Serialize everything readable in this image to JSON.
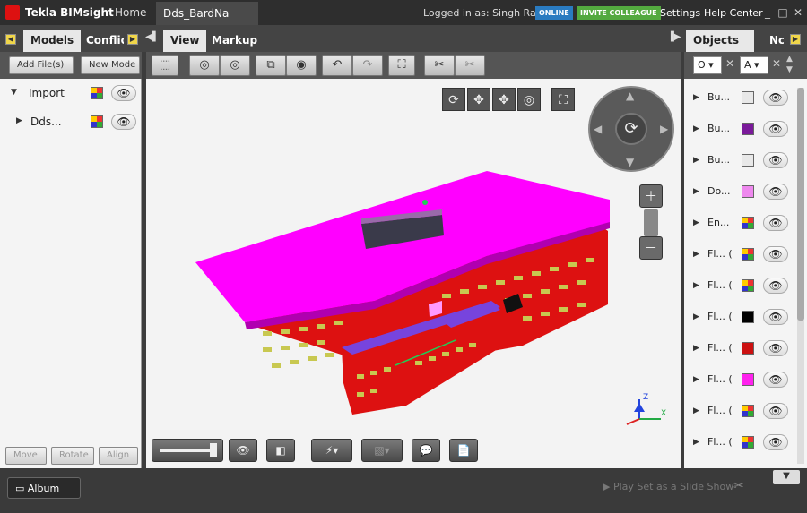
{
  "titlebar": {
    "app_name": "Tekla BIMsight",
    "home_tab": "Home",
    "document_tab": "Dds_BardNa",
    "logged_in": "Logged in as: Singh Rajan",
    "online_badge": "ONLINE",
    "invite_button": "INVITE COLLEAGUE",
    "settings": "Settings",
    "help": "Help Center",
    "minimize": "_",
    "maximize": "□",
    "close": "✕"
  },
  "left_panel": {
    "tabs": [
      "Models",
      "Conflic"
    ],
    "add_files": "Add File(s)",
    "new_model": "New Mode",
    "tree": [
      {
        "label": "Import"
      },
      {
        "label": "Dds..."
      }
    ],
    "footer_buttons": [
      "Move",
      "Rotate",
      "Align"
    ]
  },
  "center_panel": {
    "tabs": [
      "View",
      "Markup"
    ]
  },
  "right_panel": {
    "tabs": [
      "Objects",
      "Nc"
    ],
    "filter1": "O",
    "filter2": "A",
    "objects": [
      {
        "label": "Bu...",
        "swatch": "#e8e8e8",
        "multi": false
      },
      {
        "label": "Bu...",
        "swatch": "#7a1a9a",
        "multi": false
      },
      {
        "label": "Bu...",
        "swatch": "#e8e8e8",
        "multi": false
      },
      {
        "label": "Do...",
        "swatch": "#ee88ee",
        "multi": false
      },
      {
        "label": "En...",
        "swatch": "",
        "multi": true
      },
      {
        "label": "Fl... (",
        "swatch": "",
        "multi": true
      },
      {
        "label": "Fl... (",
        "swatch": "",
        "multi": true
      },
      {
        "label": "Fl... (",
        "swatch": "#000000",
        "multi": false
      },
      {
        "label": "Fl... (",
        "swatch": "#cc1111",
        "multi": false
      },
      {
        "label": "Fl... (",
        "swatch": "#ff22ee",
        "multi": false
      },
      {
        "label": "Fl... (",
        "swatch": "",
        "multi": true
      },
      {
        "label": "Fl... (",
        "swatch": "",
        "multi": true
      }
    ]
  },
  "bottombar": {
    "album": "Album",
    "slideshow": "Play Set as a Slide Show"
  },
  "colors": {
    "roof": "#ff00ff",
    "walls": "#dd1111",
    "windows": "#c8c850",
    "lower_roof": "#7744dd"
  }
}
